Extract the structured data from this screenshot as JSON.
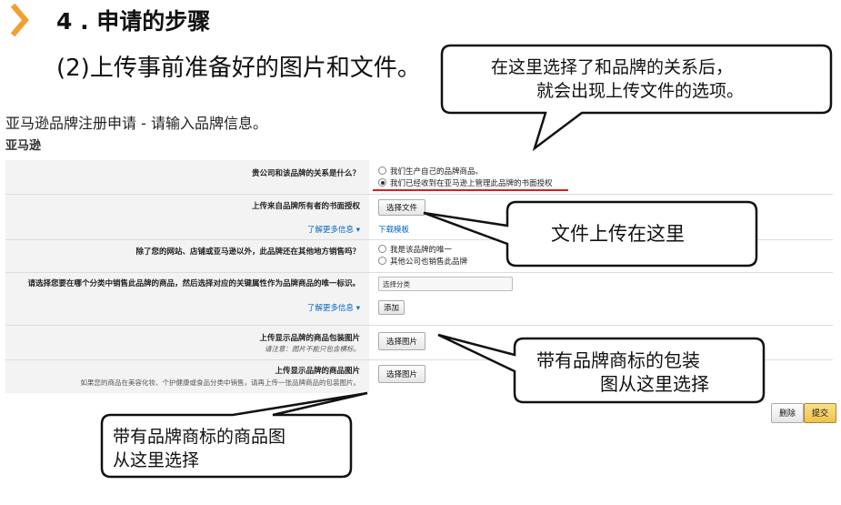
{
  "slide": {
    "step_title": "4 . 申请的步骤",
    "subtitle": "(2)上传事前准备好的图片和文件。"
  },
  "form": {
    "title": "亚马逊品牌注册申请 - 请输入品牌信息。",
    "subtitle": "亚马逊",
    "relation": {
      "question": "贵公司和该品牌的关系是什么？",
      "options": [
        "我们生产自己的品牌商品。",
        "我们已经收到在亚马逊上管理此品牌的书面授权"
      ],
      "selected_index": 1
    },
    "upload_auth": {
      "label": "上传来自品牌所有者的书面授权",
      "button": "选择文件",
      "more_info": "了解更多信息 ▾",
      "template_link": "下载模板"
    },
    "other_channels": {
      "question": "除了您的网站、店铺或亚马逊以外，此品牌还在其他地方销售吗？",
      "options": [
        "我是该品牌的唯一",
        "其他公司也销售此品牌"
      ]
    },
    "category": {
      "question": "请选择您要在哪个分类中销售此品牌的商品，然后选择对应的关键属性作为品牌商品的唯一标识。",
      "more_info": "了解更多信息 ▾",
      "select_placeholder": "选择分类",
      "add_button": "添加"
    },
    "package_image": {
      "label": "上传显示品牌的商品包装图片",
      "note": "请注意：图片不能只包含横标。",
      "button": "选择图片"
    },
    "product_image": {
      "label": "上传显示品牌的商品图片",
      "note": "如果您的商品在美容化妆、个护健康或食品分类中销售，请再上传一张品牌商品的包装图片。",
      "button": "选择图片"
    },
    "delete_button": "删除",
    "submit_button": "提交"
  },
  "callouts": {
    "relation_line1": "在这里选择了和品牌的关系后，",
    "relation_line2": "就会出现上传文件的选项。",
    "upload_here": "文件上传在这里",
    "package_line1": "带有品牌商标的包装",
    "package_line2": "图从这里选择",
    "product_line1": "带有品牌商标的商品图",
    "product_line2": "从这里选择"
  },
  "colors": {
    "accent_orange": "#f0a030",
    "link_blue": "#0066c0",
    "red_underline": "#d32020",
    "submit_yellow": "#f0c14b"
  }
}
